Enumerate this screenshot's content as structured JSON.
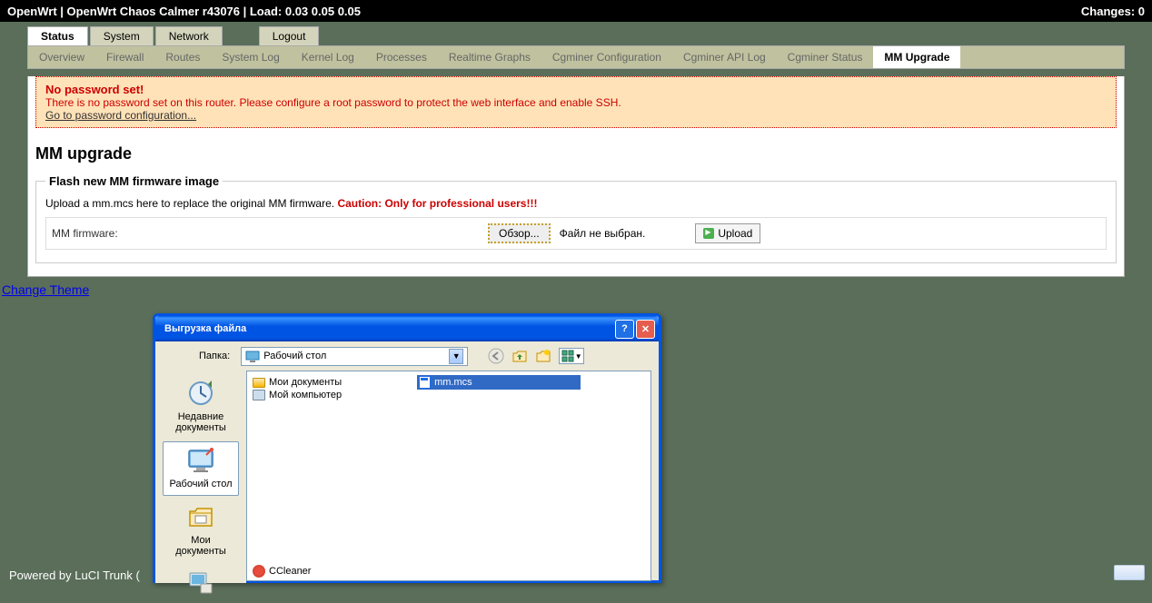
{
  "topbar": {
    "left": "OpenWrt | OpenWrt Chaos Calmer r43076 | Load: 0.03 0.05 0.05",
    "right": "Changes: 0"
  },
  "tabs": {
    "status": "Status",
    "system": "System",
    "network": "Network",
    "logout": "Logout"
  },
  "subtabs": {
    "overview": "Overview",
    "firewall": "Firewall",
    "routes": "Routes",
    "syslog": "System Log",
    "kernellog": "Kernel Log",
    "processes": "Processes",
    "realtime": "Realtime Graphs",
    "cgconf": "Cgminer Configuration",
    "cgapi": "Cgminer API Log",
    "cgstatus": "Cgminer Status",
    "mmupgrade": "MM Upgrade"
  },
  "warning": {
    "title": "No password set!",
    "text": "There is no password set on this router. Please configure a root password to protect the web interface and enable SSH.",
    "link": "Go to password configuration..."
  },
  "page": {
    "title": "MM upgrade"
  },
  "fieldset": {
    "legend": "Flash new MM firmware image",
    "upload_text": "Upload a mm.mcs here to replace the original MM firmware. ",
    "caution": "Caution: Only for professional users!!!",
    "label": "MM firmware:",
    "browse": "Обзор...",
    "file_status": "Файл не выбран.",
    "upload": "Upload"
  },
  "change_theme": "Change Theme",
  "footer": "Powered by LuCI Trunk (",
  "dialog": {
    "title": "Выгрузка файла",
    "folder_label": "Папка:",
    "folder_value": "Рабочий стол",
    "sidebar": {
      "recent": "Недавние документы",
      "desktop": "Рабочий стол",
      "mydocs": "Мои документы"
    },
    "files": {
      "mydocs": "Мои документы",
      "mycomp": "Мой компьютер",
      "mmmcs": "mm.mcs",
      "ccleaner": "CCleaner"
    }
  }
}
